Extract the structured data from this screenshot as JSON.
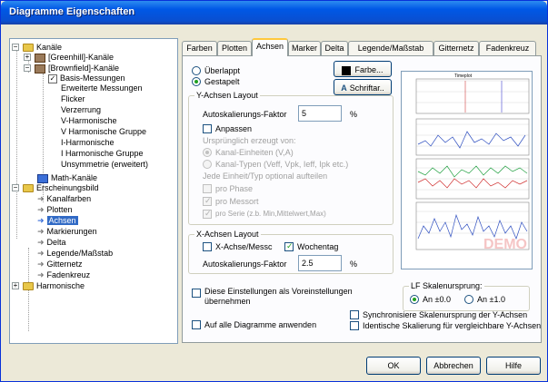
{
  "window": {
    "title": "Diagramme Eigenschaften"
  },
  "tree": {
    "items": [
      {
        "label": "Kanäle"
      },
      {
        "label": "[Greenhill]-Kanäle"
      },
      {
        "label": "[Brownfield]-Kanäle"
      },
      {
        "label": "Basis-Messungen"
      },
      {
        "label": "Erweiterte Messungen"
      },
      {
        "label": "Flicker"
      },
      {
        "label": "Verzerrung"
      },
      {
        "label": "V-Harmonische"
      },
      {
        "label": "V Harmonische Gruppe"
      },
      {
        "label": "I-Harmonische"
      },
      {
        "label": "I Harmonische Gruppe"
      },
      {
        "label": "Unsymmetrie (erweitert)"
      },
      {
        "label": "Math-Kanäle"
      },
      {
        "label": "Erscheinungsbild"
      },
      {
        "label": "Kanalfarben"
      },
      {
        "label": "Plotten"
      },
      {
        "label": "Achsen"
      },
      {
        "label": "Markierungen"
      },
      {
        "label": "Delta"
      },
      {
        "label": "Legende/Maßstab"
      },
      {
        "label": "Gitternetz"
      },
      {
        "label": "Fadenkreuz"
      },
      {
        "label": "Harmonische"
      }
    ]
  },
  "tabs": [
    "Farben",
    "Plotten",
    "Achsen",
    "Marker",
    "Delta",
    "Legende/Maßstab",
    "Gitternetz",
    "Fadenkreuz"
  ],
  "active_tab": "Achsen",
  "options": {
    "ueberlappt": "Überlappt",
    "gestapelt": "Gestapelt",
    "farbe_button": "Farbe...",
    "schriftart_button": "Schriftar.."
  },
  "y_layout": {
    "title": "Y-Achsen Layout",
    "autoscale_label": "Autoskalierungs-Faktor",
    "autoscale_value": "5",
    "autoscale_unit": "%",
    "anpassen": "Anpassen",
    "ursprung": "Ursprünglich erzeugt von:",
    "kanal_einheiten": "Kanal-Einheiten (V,A)",
    "kanal_typen": "Kanal-Typen (Veff, Vpk, Ieff, Ipk etc.)",
    "jede_einheit": "Jede Einheit/Typ optional aufteilen",
    "pro_phase": "pro Phase",
    "pro_messort": "pro Messort",
    "pro_serie": "pro Serie (z.b. Min,Mittelwert,Max)"
  },
  "x_layout": {
    "title": "X-Achsen Layout",
    "x_achse_messort": "X-Achse/Messc",
    "wochentag": "Wochentag",
    "autoscale_label": "Autoskalierungs-Faktor",
    "autoscale_value": "2.5",
    "autoscale_unit": "%"
  },
  "defaults_checkbox": "Diese Einstellungen als Voreinstellungen übernehmen",
  "apply_all_checkbox": "Auf alle Diagramme anwenden",
  "lf": {
    "title": "LF Skalenursprung:",
    "an0": "An ±0.0",
    "an1": "An ±1.0"
  },
  "sync_checkbox": "Synchronisiere Skalenursprung der Y-Achsen",
  "ident_checkbox": "Identische Skalierung für vergleichbare Y-Achsen",
  "preview": {
    "title": "Timeplot",
    "watermark": "DEMO"
  },
  "buttons": {
    "ok": "OK",
    "abbrechen": "Abbrechen",
    "hilfe": "Hilfe"
  }
}
